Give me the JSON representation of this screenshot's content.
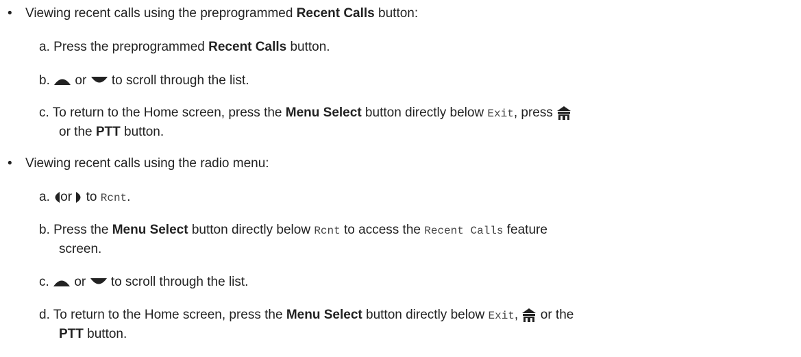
{
  "bullet_char": "•",
  "section1": {
    "intro_before": "Viewing recent calls using the preprogrammed ",
    "intro_bold": "Recent Calls",
    "intro_after": " button:",
    "step_a": {
      "letter": "a.",
      "before": "Press the preprogrammed ",
      "bold": "Recent Calls",
      "after": " button."
    },
    "step_b": {
      "letter": "b.",
      "or": "or",
      "after": "to scroll through the list."
    },
    "step_c": {
      "letter": "c.",
      "before": "To return to the Home screen, press the ",
      "bold": "Menu Select",
      "mid": " button directly below ",
      "mono": "Exit",
      "after": ", press",
      "line2_before": "or the ",
      "line2_bold": "PTT",
      "line2_after": " button."
    }
  },
  "section2": {
    "intro": "Viewing recent calls using the radio menu:",
    "step_a": {
      "letter": "a.",
      "or": "or",
      "to": "to",
      "mono": "Rcnt",
      "after": "."
    },
    "step_b": {
      "letter": "b.",
      "before": "Press the ",
      "bold": "Menu Select",
      "mid": " button directly below ",
      "mono1": "Rcnt",
      "mid2": " to access the ",
      "mono2": "Recent Calls",
      "after": " feature",
      "line2": "screen."
    },
    "step_c": {
      "letter": "c.",
      "or": "or",
      "after": "to scroll through the list."
    },
    "step_d": {
      "letter": "d.",
      "before": "To return to the Home screen, press the ",
      "bold": "Menu Select",
      "mid": " button directly below ",
      "mono": "Exit",
      "after": ",",
      "after2": "or the",
      "line2_bold": "PTT",
      "line2_after": " button."
    }
  },
  "icons": {
    "up": "up-arrow-icon",
    "down": "down-arrow-icon",
    "left": "left-arrow-icon",
    "right": "right-arrow-icon",
    "home": "home-icon"
  }
}
